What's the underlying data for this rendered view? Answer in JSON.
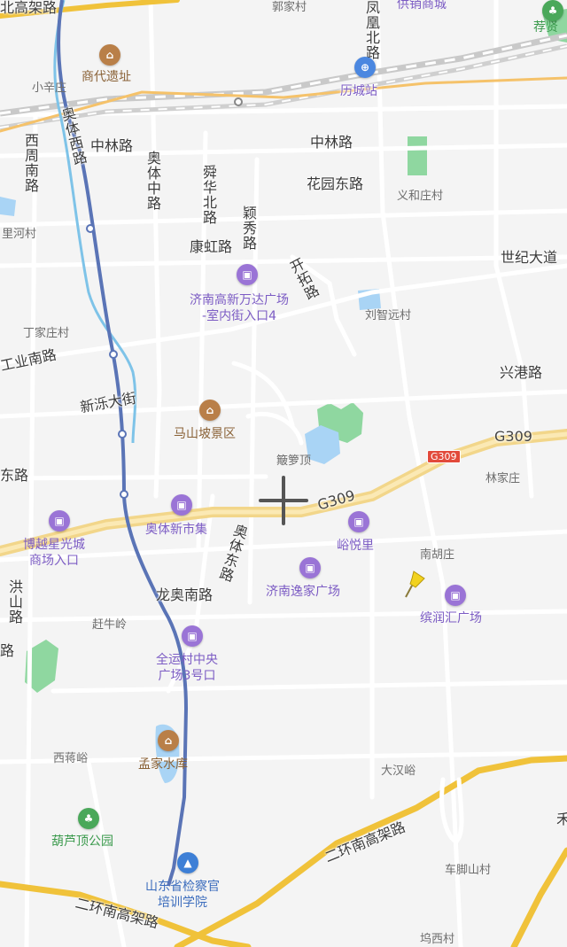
{
  "map": {
    "roads": {
      "north_elevated": "北高架路",
      "fenghuang_north": "凤凰北路",
      "aoti_west": "奥体西路",
      "xizhou_south": "西周南路",
      "zhonglin_west": "中林路",
      "zhonglin_east": "中林路",
      "aoti_middle": "奥体中路",
      "shunhua_north": "舜华北路",
      "yingxiu": "颖秀路",
      "huayuan_east": "花园东路",
      "kanghong": "康虹路",
      "kaituo": "开拓路",
      "century_avenue": "世纪大道",
      "industrial_south": "工业南路",
      "xingang": "兴港路",
      "xinluo_avenue": "新泺大街",
      "dong_road": "东路",
      "aoti_east": "奥体东路",
      "longao_south": "龙奥南路",
      "hongshan": "洪山路",
      "left_edge_road": "路",
      "second_ring_south_elevated_a": "二环南高架路",
      "second_ring_south_elevated_b": "二环南高架路"
    },
    "highway": {
      "name_text_1": "G309",
      "name_text_2": "G309",
      "shield": "G309"
    },
    "villages": {
      "guojia": "郭家村",
      "xiaoxin": "小辛庄",
      "lihe": "里河村",
      "yiheizhuang": "义和庄村",
      "dingjiazhuang": "丁家庄村",
      "liuzhiyuan": "刘智远村",
      "pomiding": "簸箩顶",
      "linjiazhuang": "林家庄",
      "nanhuzhuang": "南胡庄",
      "ganniuling": "赶牛岭",
      "xijiangyu": "西蒋峪",
      "dahanyu": "大汉峪",
      "chejiaoshan": "车脚山村",
      "xi_village_bottom": "坞西村"
    },
    "pois": {
      "gongxiao": "供销商城",
      "jianxian": "荐贤",
      "shangdai": "商代遗址",
      "licheng_station": "历城站",
      "wanda": [
        "济南高新万达广场",
        "-室内街入口4"
      ],
      "mashanpo": "马山坡景区",
      "aoti_xinshiji": "奥体新市集",
      "yuyueli": "峪悦里",
      "boyue": [
        "博越星光城",
        "商场入口"
      ],
      "jinan_yijia": "济南逸家广场",
      "binrunhui": "缤润汇广场",
      "quanyun": [
        "全运村中央",
        "广场3号口"
      ],
      "mengjia_reservoir": "孟家水库",
      "huluding_park": "葫芦顶公园",
      "procuratorate": [
        "山东省检察官",
        "培训学院"
      ],
      "right_edge": "禾"
    },
    "icons": {
      "shop": "shopping-bag-icon",
      "tour": "scenic-spot-icon",
      "park": "park-tree-icon",
      "edu": "graduation-cap-icon",
      "station": "train-station-icon",
      "crosshair": "crosshair-icon",
      "pin": "thumbtack-pin-icon"
    },
    "colors": {
      "background": "#f4f4f4",
      "highway": "#f2d68a",
      "expressway": "#f0c23a",
      "river": "#7ec3e8",
      "metro": "#5a74b6",
      "green": "#8fd7a0",
      "water": "#a9d4f5",
      "poi_shop": "#9a74d6"
    }
  }
}
